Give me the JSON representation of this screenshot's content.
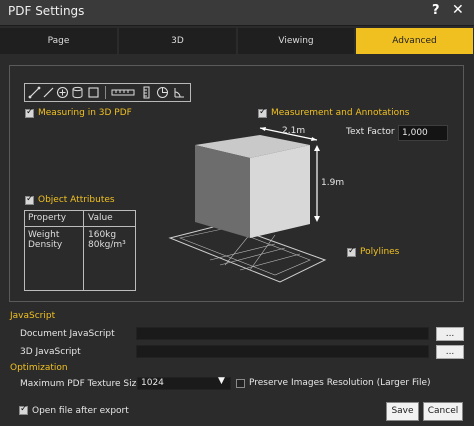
{
  "window": {
    "title": "PDF Settings",
    "help_icon": "?",
    "close_icon": "✕"
  },
  "tabs": [
    {
      "label": "Page"
    },
    {
      "label": "3D"
    },
    {
      "label": "Viewing"
    },
    {
      "label": "Advanced",
      "active": true
    }
  ],
  "toolbar": {
    "groups": [
      [
        "point-to-point-icon",
        "line-icon",
        "radial-icon",
        "cylinder-icon",
        "box-icon"
      ],
      [
        "ruler-icon",
        "height-icon",
        "thickness-icon",
        "angle-icon",
        "area-icon"
      ]
    ]
  },
  "options": {
    "measuring_3d": {
      "label": "Measuring in 3D PDF",
      "checked": true
    },
    "measurement_annotations": {
      "label": "Measurement and Annotations",
      "checked": true
    },
    "text_factor_label": "Text Factor",
    "text_factor_value": "1,000",
    "object_attributes": {
      "label": "Object Attributes",
      "checked": true
    },
    "polylines": {
      "label": "Polylines",
      "checked": true
    }
  },
  "preview": {
    "width_label": "2.1m",
    "height_label": "1.9m",
    "table": {
      "headers": [
        "Property",
        "Value"
      ],
      "properties": [
        "Weight",
        "Density"
      ],
      "values": [
        "160kg",
        "80kg/m³"
      ]
    }
  },
  "javascript": {
    "section": "JavaScript",
    "document_label": "Document JavaScript",
    "document_value": "",
    "d3_label": "3D JavaScript",
    "d3_value": "",
    "browse_label": "..."
  },
  "optimization": {
    "section": "Optimization",
    "texture_label": "Maximum PDF Texture Size",
    "texture_value": "1024",
    "preserve_label": "Preserve Images Resolution (Larger File)",
    "preserve_checked": false
  },
  "footer": {
    "open_after_export": {
      "label": "Open file after export",
      "checked": true
    },
    "save_label": "Save",
    "cancel_label": "Cancel"
  },
  "colors": {
    "accent": "#f0c021",
    "background": "#2b2b2b",
    "tab_bg": "#1f1f1f"
  }
}
